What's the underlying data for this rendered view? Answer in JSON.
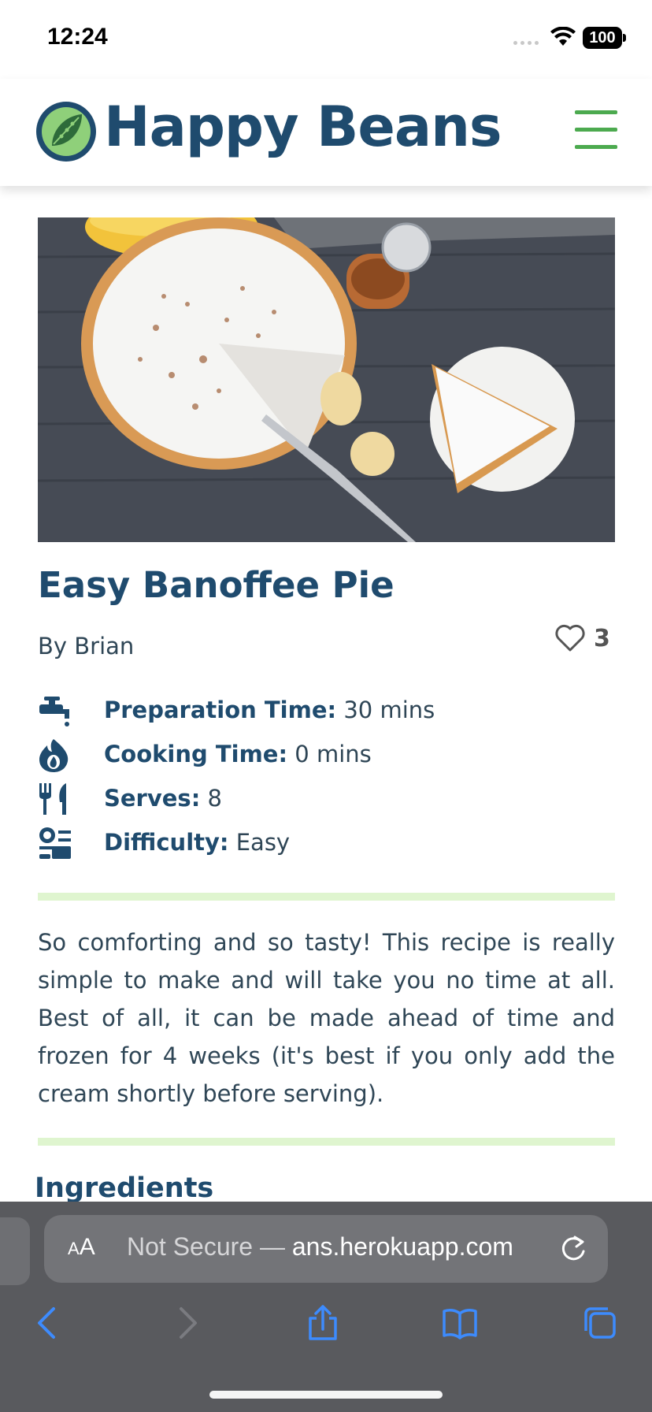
{
  "status_bar": {
    "time": "12:24",
    "battery": "100"
  },
  "header": {
    "brand": "Happy Beans"
  },
  "recipe": {
    "title": "Easy Banoffee Pie",
    "author": "By Brian",
    "likes": "3",
    "facts": [
      {
        "label": "Preparation Time:",
        "value": " 30 mins",
        "icon": "tap-icon"
      },
      {
        "label": "Cooking Time:",
        "value": " 0 mins",
        "icon": "flame-icon"
      },
      {
        "label": "Serves:",
        "value": " 8",
        "icon": "cutlery-icon"
      },
      {
        "label": "Difficulty:",
        "value": " Easy",
        "icon": "chef-icon"
      }
    ],
    "description": "So comforting and so tasty! This recipe is really simple to make and will take you no time at all. Best of all, it can be made ahead of time and frozen for 4 weeks (it's best if you only add the cream shortly before serving).",
    "ingredients_heading": "Ingredients"
  },
  "browser": {
    "aa_small": "A",
    "aa_big": "A",
    "url_prefix": "Not Secure — ",
    "url_host": "ans.herokuapp.com"
  },
  "colors": {
    "brand": "#1f4b6e",
    "accent_green": "#4caa4f",
    "divider": "#dff5cf",
    "browser_bar": "#595a5e",
    "toolbar_icon": "#3d8bfd"
  }
}
